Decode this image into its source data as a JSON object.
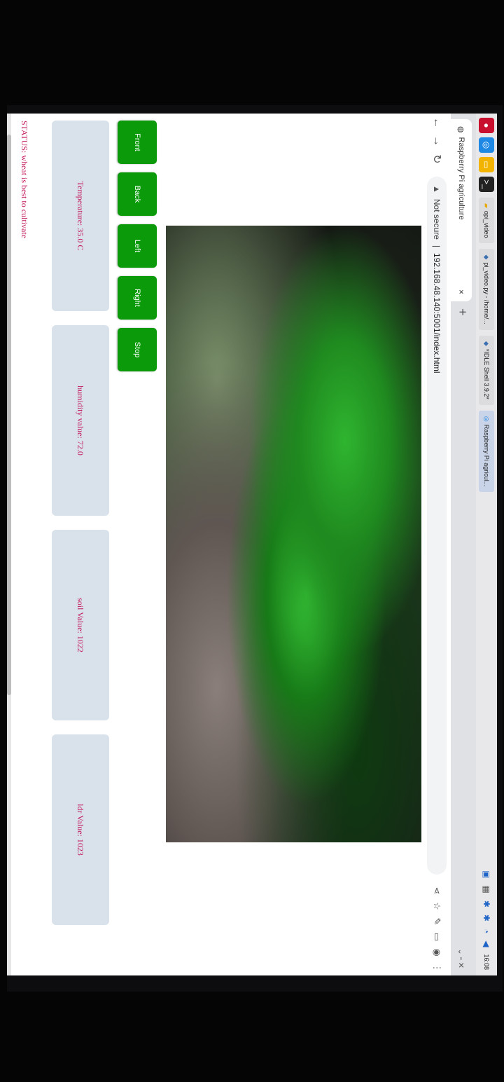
{
  "taskbar": {
    "tasks": [
      {
        "label": "opi_video",
        "active": false
      },
      {
        "label": "pi_video.py - /home/...",
        "active": false
      },
      {
        "label": "*IDLE Shell 3.9.2*",
        "active": false
      },
      {
        "label": "Raspberry Pi agricul...",
        "active": true
      }
    ],
    "window_title": "Raspberry Pi agriculture - Chromium",
    "clock": "16:08"
  },
  "browser": {
    "tab_title": "Raspberry Pi agriculture",
    "tab_close": "×",
    "new_tab": "+",
    "security_label": "Not secure",
    "url": "192.168.48.140:5001/index.html"
  },
  "controls": [
    "Front",
    "Back",
    "Left",
    "Right",
    "Stop"
  ],
  "sensors": {
    "temperature": "Temperature: 35.0 C",
    "humidity": "humidity value: 72.0",
    "soil": "soil Value: 1022",
    "ldr": "ldr Value: 1023"
  },
  "status": "STATUS: wheat is best to cultivate"
}
